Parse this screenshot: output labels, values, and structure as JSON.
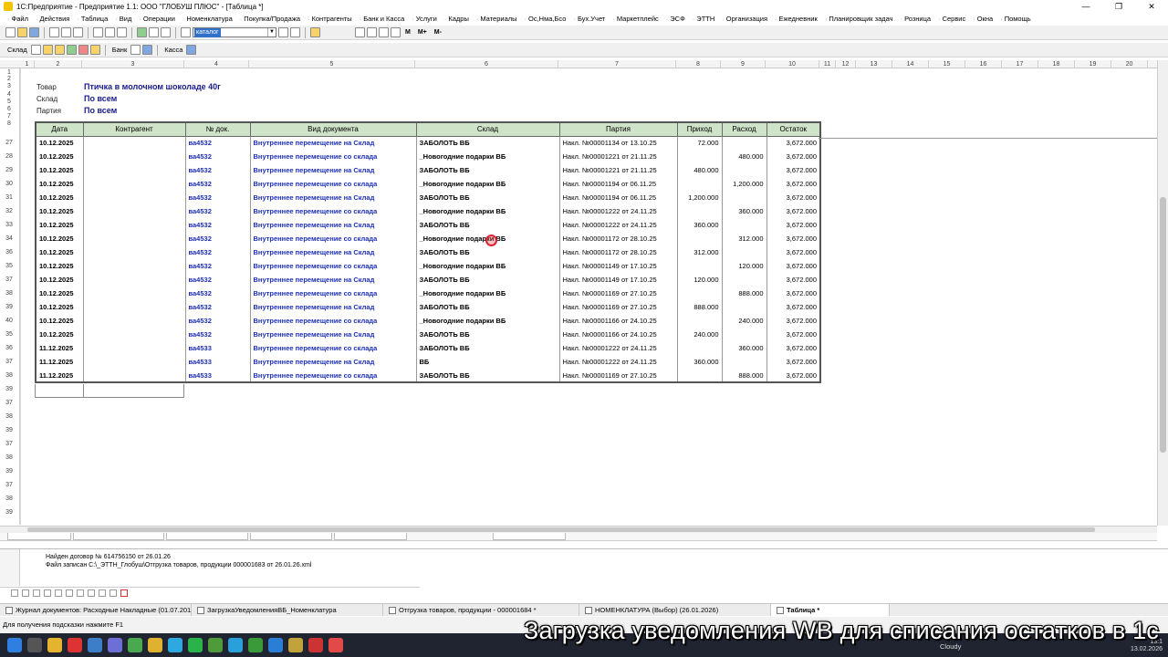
{
  "window": {
    "title": "1С:Предприятие - Предприятие 1.1: ООО \"ГЛОБУШ ПЛЮС\" - [Таблица  *]",
    "controls": [
      "—",
      "❐",
      "✕"
    ]
  },
  "menu": [
    "Файл",
    "Действия",
    "Таблица",
    "Вид",
    "Операции",
    "Номенклатура",
    "Покупка/Продажа",
    "Контрагенты",
    "Банк и Касса",
    "Услуги",
    "Кадры",
    "Материалы",
    "Ос,Нма,Бсо",
    "Бух.Учет",
    "Маркетплейс",
    "ЭСФ",
    "ЭТТН",
    "Организация",
    "Ежедневник",
    "Планировщик задач",
    "Розница",
    "Сервис",
    "Окна",
    "Помощь"
  ],
  "toolbar": {
    "search_value": "каталог",
    "m_label": "M",
    "m_plus": "M+",
    "m_minus": "M-",
    "sklad": "Склад",
    "bank": "Банк",
    "kassa": "Касса"
  },
  "colheader": [
    "1",
    "2",
    "3",
    "4",
    "5",
    "6",
    "7",
    "8",
    "9",
    "10",
    "11",
    "12",
    "13",
    "14",
    "15",
    "16",
    "17",
    "18",
    "19",
    "20"
  ],
  "rowheader": [
    "1",
    "2",
    "3",
    "4",
    "5",
    "6",
    "7",
    "8",
    "27",
    "28",
    "29",
    "30",
    "31",
    "32",
    "33",
    "34",
    "36",
    "35",
    "37",
    "38",
    "39",
    "40",
    "35",
    "36",
    "37",
    "38",
    "39",
    "37",
    "38",
    "39",
    "37",
    "38",
    "39",
    "37",
    "38",
    "39",
    "37",
    "38",
    "39"
  ],
  "report": {
    "product_label": "Товар",
    "product_value": "Птичка в молочном шоколаде 40г",
    "warehouse_label": "Склад",
    "warehouse_value": "По всем",
    "batch_label": "Партия",
    "batch_value": "По всем"
  },
  "table": {
    "columns": [
      "Дата",
      "Контрагент",
      "№ док.",
      "Вид документа",
      "Склад",
      "Партия",
      "Приход",
      "Расход",
      "Остаток"
    ],
    "rows": [
      [
        "10.12.2025",
        "",
        "ва4532",
        "Внутреннее перемещение на Склад",
        "ЗАБОЛОТЬ ВБ",
        "Накл. №00001134  от 13.10.25",
        "72.000",
        "",
        "3,672.000"
      ],
      [
        "10.12.2025",
        "",
        "ва4532",
        "Внутреннее перемещение со склада",
        "_Новогодние подарки ВБ",
        "Накл. №00001221  от 21.11.25",
        "",
        "480.000",
        "3,672.000"
      ],
      [
        "10.12.2025",
        "",
        "ва4532",
        "Внутреннее перемещение на Склад",
        "ЗАБОЛОТЬ ВБ",
        "Накл. №00001221  от 21.11.25",
        "480.000",
        "",
        "3,672.000"
      ],
      [
        "10.12.2025",
        "",
        "ва4532",
        "Внутреннее перемещение со склада",
        "_Новогодние подарки ВБ",
        "Накл. №00001194  от 06.11.25",
        "",
        "1,200.000",
        "3,672.000"
      ],
      [
        "10.12.2025",
        "",
        "ва4532",
        "Внутреннее перемещение на Склад",
        "ЗАБОЛОТЬ ВБ",
        "Накл. №00001194  от 06.11.25",
        "1,200.000",
        "",
        "3,672.000"
      ],
      [
        "10.12.2025",
        "",
        "ва4532",
        "Внутреннее перемещение со склада",
        "_Новогодние подарки ВБ",
        "Накл. №00001222  от 24.11.25",
        "",
        "360.000",
        "3,672.000"
      ],
      [
        "10.12.2025",
        "",
        "ва4532",
        "Внутреннее перемещение на Склад",
        "ЗАБОЛОТЬ ВБ",
        "Накл. №00001222  от 24.11.25",
        "360.000",
        "",
        "3,672.000"
      ],
      [
        "10.12.2025",
        "",
        "ва4532",
        "Внутреннее перемещение со склада",
        "_Новогодние подарки ВБ",
        "Накл. №00001172  от 28.10.25",
        "",
        "312.000",
        "3,672.000"
      ],
      [
        "10.12.2025",
        "",
        "ва4532",
        "Внутреннее перемещение на Склад",
        "ЗАБОЛОТЬ ВБ",
        "Накл. №00001172  от 28.10.25",
        "312.000",
        "",
        "3,672.000"
      ],
      [
        "10.12.2025",
        "",
        "ва4532",
        "Внутреннее перемещение со склада",
        "_Новогодние подарки ВБ",
        "Накл. №00001149  от 17.10.25",
        "",
        "120.000",
        "3,672.000"
      ],
      [
        "10.12.2025",
        "",
        "ва4532",
        "Внутреннее перемещение на Склад",
        "ЗАБОЛОТЬ ВБ",
        "Накл. №00001149  от 17.10.25",
        "120.000",
        "",
        "3,672.000"
      ],
      [
        "10.12.2025",
        "",
        "ва4532",
        "Внутреннее перемещение со склада",
        "_Новогодние подарки ВБ",
        "Накл. №00001169  от 27.10.25",
        "",
        "888.000",
        "3,672.000"
      ],
      [
        "10.12.2025",
        "",
        "ва4532",
        "Внутреннее перемещение на Склад",
        "ЗАБОЛОТЬ ВБ",
        "Накл. №00001169  от 27.10.25",
        "888.000",
        "",
        "3,672.000"
      ],
      [
        "10.12.2025",
        "",
        "ва4532",
        "Внутреннее перемещение со склада",
        "_Новогодние подарки ВБ",
        "Накл. №00001166  от 24.10.25",
        "",
        "240.000",
        "3,672.000"
      ],
      [
        "10.12.2025",
        "",
        "ва4532",
        "Внутреннее перемещение на Склад",
        "ЗАБОЛОТЬ ВБ",
        "Накл. №00001166  от 24.10.25",
        "240.000",
        "",
        "3,672.000"
      ],
      [
        "11.12.2025",
        "",
        "ва4533",
        "Внутреннее перемещение со склада",
        "ЗАБОЛОТЬ ВБ",
        "Накл. №00001222  от 24.11.25",
        "",
        "360.000",
        "3,672.000"
      ],
      [
        "11.12.2025",
        "",
        "ва4533",
        "Внутреннее перемещение на Склад",
        "ВБ",
        "Накл. №00001222  от 24.11.25",
        "360.000",
        "",
        "3,672.000"
      ],
      [
        "11.12.2025",
        "",
        "ва4533",
        "Внутреннее перемещение со склада",
        "ЗАБОЛОТЬ ВБ",
        "Накл. №00001169  от 27.10.25",
        "",
        "888.000",
        "3,672.000"
      ]
    ]
  },
  "messages": {
    "line1": "Найден договор № 614756150 от 26.01.26",
    "line2": "Файл записан C:\\_ЭТТН_Глобуш\\Отгрузка товаров, продукции 000001683 от 26.01.26.xml"
  },
  "window_tabs": [
    "Журнал документов: Расходные Накладные (01.07.2019...",
    "ЗагрузкаУведомленияВБ_Номенклатура",
    "Отгрузка товаров, продукции - 000001684 *",
    "НОМЕНКЛАТУРА (Выбор) (26.01.2026)",
    "Таблица  *"
  ],
  "status_hint": "Для получения подсказки нажмите F1",
  "taskbar": {
    "weather": "Cloudy",
    "time": "13:1",
    "date": "13.02.2026"
  },
  "caption": "Загрузка уведомления WB для списания остатков в 1с",
  "colors": {
    "header_green": "#cfe3c8",
    "link_blue": "#1c2fb5",
    "caption_text": "#ffffff"
  }
}
